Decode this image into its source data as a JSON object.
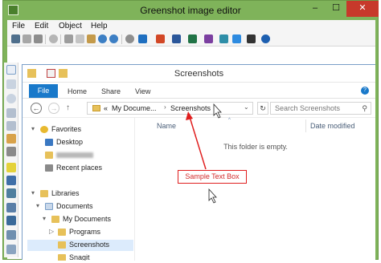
{
  "window": {
    "title": "Greenshot image editor",
    "controls": {
      "minimize": "–",
      "maximize": "☐",
      "close": "✕"
    }
  },
  "menubar": {
    "items": [
      "File",
      "Edit",
      "Object",
      "Help"
    ]
  },
  "toolbar": {
    "icons": [
      "save-icon",
      "clipboard-icon",
      "print-icon",
      "delete-icon",
      "cut-icon",
      "copy-icon",
      "paste-icon",
      "undo-icon",
      "redo-icon",
      "settings-icon",
      "outlook-icon",
      "powerpoint-icon",
      "word-icon",
      "excel-icon",
      "onenote-icon",
      "imgur-icon",
      "dropbox-icon",
      "box-icon",
      "help-icon"
    ]
  },
  "left_tools": {
    "icons": [
      "cursor-tool-icon",
      "rectangle-tool-icon",
      "ellipse-tool-icon",
      "line-tool-icon",
      "arrow-tool-icon",
      "freehand-tool-icon",
      "text-tool-icon",
      "highlight-tool-icon",
      "obfuscate-tool-icon",
      "counter-tool-icon",
      "speechbubble-tool-icon",
      "crop-tool-icon",
      "image-tool-icon",
      "rotate-tool-icon",
      "resize-tool-icon",
      "torn-edge-tool-icon"
    ]
  },
  "explorer": {
    "title": "Screenshots",
    "ribbon_tabs": [
      "File",
      "Home",
      "Share",
      "View"
    ],
    "help": "?",
    "nav_buttons": {
      "back": "←",
      "forward": "→",
      "up": "↑"
    },
    "address": {
      "overflow": "«",
      "segments": [
        "My Docume...",
        "Screenshots"
      ],
      "separator": "›",
      "dropdown": "⌄",
      "refresh": "↻"
    },
    "search_placeholder": "Search Screenshots",
    "search_icon": "⚲",
    "nav_pane": [
      {
        "label": "Favorites",
        "icon": "star-icon",
        "color": "#e8b930",
        "level": 0,
        "expand": "▾"
      },
      {
        "label": "Desktop",
        "icon": "desktop-icon",
        "color": "#3a78c2",
        "level": 1
      },
      {
        "label": "",
        "icon": "user-folder-icon",
        "color": "#e7c15a",
        "level": 1,
        "redacted": true
      },
      {
        "label": "Recent places",
        "icon": "recent-places-icon",
        "color": "#8a8a8a",
        "level": 1
      },
      {
        "label": "Libraries",
        "icon": "libraries-icon",
        "color": "#e7c15a",
        "level": 0,
        "expand": "▾"
      },
      {
        "label": "Documents",
        "icon": "documents-icon",
        "color": "#c9d8ea",
        "level": 1,
        "expand": "▾"
      },
      {
        "label": "My Documents",
        "icon": "folder-icon",
        "color": "#e7c15a",
        "level": 2,
        "expand": "▾"
      },
      {
        "label": "Programs",
        "icon": "folder-icon",
        "color": "#e7c15a",
        "level": 3,
        "expand": "▷"
      },
      {
        "label": "Screenshots",
        "icon": "folder-icon",
        "color": "#e7c15a",
        "level": 3,
        "selected": true
      },
      {
        "label": "Snagit",
        "icon": "folder-icon",
        "color": "#e7c15a",
        "level": 3,
        "expand": "▷"
      }
    ],
    "columns": {
      "name": "Name",
      "date_modified": "Date modified",
      "sort_arrow": "^"
    },
    "empty_message": "This folder is empty."
  },
  "annotation": {
    "text_box": "Sample Text Box",
    "color": "#e01e1e"
  },
  "colors": {
    "greenshot_frame": "#7fb35a",
    "explorer_accent": "#1979ca",
    "selection": "#dcebfc"
  }
}
